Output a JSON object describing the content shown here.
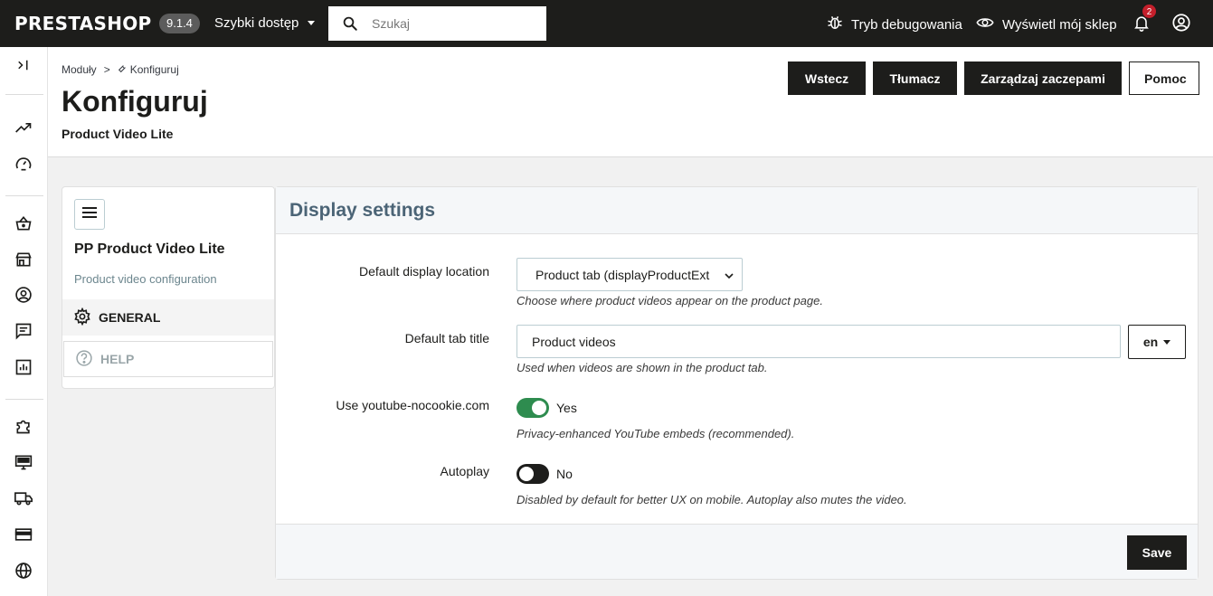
{
  "topbar": {
    "logo": "PRESTASHOP",
    "version": "9.1.4",
    "quick_access": "Szybki dostęp",
    "search_placeholder": "Szukaj",
    "debug": "Tryb debugowania",
    "view_shop": "Wyświetl mój sklep",
    "notifications_count": "2"
  },
  "header": {
    "breadcrumb": [
      "Moduły",
      "Konfiguruj"
    ],
    "breadcrumb_sep": ">",
    "title": "Konfiguruj",
    "subtitle": "Product Video Lite",
    "buttons": {
      "back": "Wstecz",
      "translate": "Tłumacz",
      "hooks": "Zarządzaj zaczepami",
      "help": "Pomoc"
    }
  },
  "left_panel": {
    "module_name": "PP Product Video Lite",
    "module_desc": "Product video configuration",
    "nav": {
      "general": "GENERAL",
      "help": "HELP"
    }
  },
  "settings": {
    "title": "Display settings",
    "location": {
      "label": "Default display location",
      "value": "Product tab (displayProductExt",
      "help": "Choose where product videos appear on the product page."
    },
    "tab_title": {
      "label": "Default tab title",
      "value": "Product videos",
      "lang": "en",
      "help": "Used when videos are shown in the product tab."
    },
    "nocookie": {
      "label": "Use youtube-nocookie.com",
      "state": "Yes",
      "on": true,
      "help": "Privacy-enhanced YouTube embeds (recommended)."
    },
    "autoplay": {
      "label": "Autoplay",
      "state": "No",
      "on": false,
      "help": "Disabled by default for better UX on mobile. Autoplay also mutes the video."
    },
    "save": "Save"
  },
  "colors": {
    "toggle_on": "#2e8c4f",
    "dark": "#1d1d1b",
    "panel_title": "#4b6476"
  }
}
